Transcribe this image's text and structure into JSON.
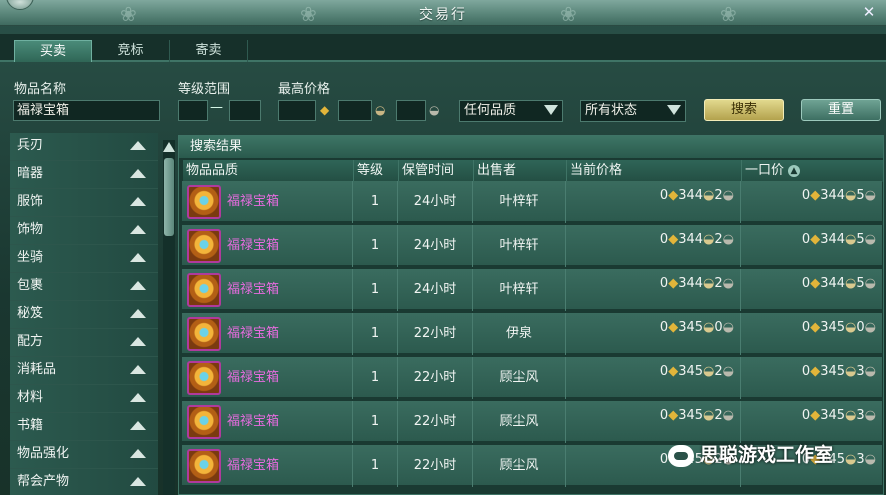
{
  "window": {
    "title": "交易行",
    "close_glyph": "✕"
  },
  "tabs": [
    {
      "label": "买卖",
      "active": true
    },
    {
      "label": "竞标",
      "active": false
    },
    {
      "label": "寄卖",
      "active": false
    }
  ],
  "filters": {
    "item_name_label": "物品名称",
    "item_name_value": "福禄宝箱",
    "level_range_label": "等级范围",
    "level_sep": "—",
    "max_price_label": "最高价格",
    "quality_select": "任何品质",
    "status_select": "所有状态",
    "search_button": "搜索",
    "reset_button": "重置"
  },
  "categories": [
    "兵刃",
    "暗器",
    "服饰",
    "饰物",
    "坐骑",
    "包裹",
    "秘笈",
    "配方",
    "消耗品",
    "材料",
    "书籍",
    "物品强化",
    "帮会产物"
  ],
  "results": {
    "title": "搜索结果",
    "columns": [
      "物品品质",
      "等级",
      "保管时间",
      "出售者",
      "当前价格",
      "一口价"
    ],
    "rows": [
      {
        "name": "福禄宝箱",
        "level": "1",
        "time": "24小时",
        "seller": "叶梓轩",
        "cur": [
          "0",
          "344",
          "2"
        ],
        "buy": [
          "0",
          "344",
          "5"
        ]
      },
      {
        "name": "福禄宝箱",
        "level": "1",
        "time": "24小时",
        "seller": "叶梓轩",
        "cur": [
          "0",
          "344",
          "2"
        ],
        "buy": [
          "0",
          "344",
          "5"
        ]
      },
      {
        "name": "福禄宝箱",
        "level": "1",
        "time": "24小时",
        "seller": "叶梓轩",
        "cur": [
          "0",
          "344",
          "2"
        ],
        "buy": [
          "0",
          "344",
          "5"
        ]
      },
      {
        "name": "福禄宝箱",
        "level": "1",
        "time": "22小时",
        "seller": "伊泉",
        "cur": [
          "0",
          "345",
          "0"
        ],
        "buy": [
          "0",
          "345",
          "0"
        ]
      },
      {
        "name": "福禄宝箱",
        "level": "1",
        "time": "22小时",
        "seller": "顾尘风",
        "cur": [
          "0",
          "345",
          "2"
        ],
        "buy": [
          "0",
          "345",
          "3"
        ]
      },
      {
        "name": "福禄宝箱",
        "level": "1",
        "time": "22小时",
        "seller": "顾尘风",
        "cur": [
          "0",
          "345",
          "2"
        ],
        "buy": [
          "0",
          "345",
          "3"
        ]
      },
      {
        "name": "福禄宝箱",
        "level": "1",
        "time": "22小时",
        "seller": "顾尘风",
        "cur": [
          "0",
          "345",
          "2"
        ],
        "buy": [
          "0",
          "345",
          "3"
        ]
      }
    ]
  },
  "watermark": "思聪游戏工作室",
  "colors": {
    "item_name": "#e86ce0",
    "gold": "#e2b53a",
    "panel": "#1a3a32"
  }
}
